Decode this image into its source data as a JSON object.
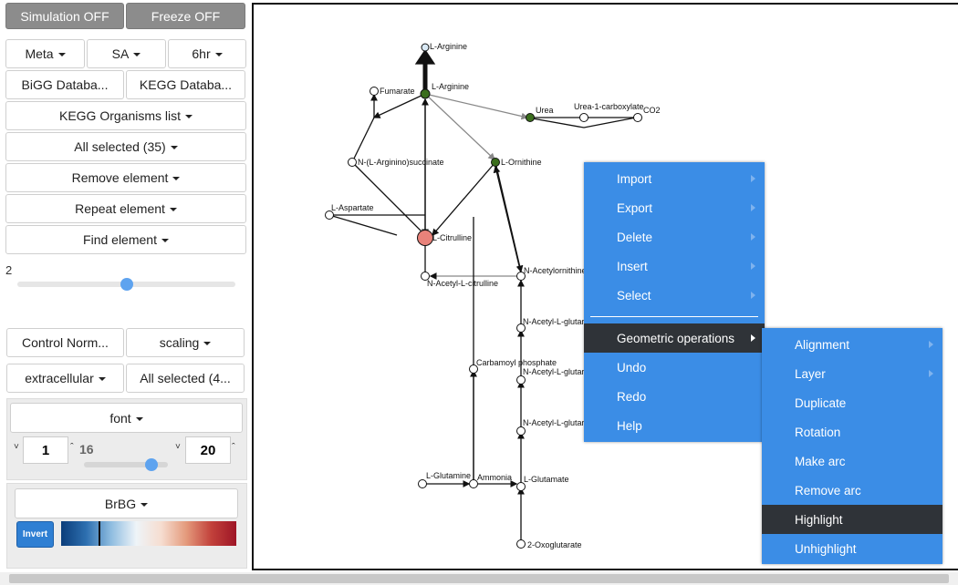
{
  "toolbar": {
    "simulation": "Simulation OFF",
    "freeze": "Freeze OFF"
  },
  "sidebar": {
    "meta": "Meta",
    "sa": "SA",
    "time": "6hr",
    "bigg": "BiGG Databa...",
    "kegg": "KEGG Databa...",
    "kegg_org": "KEGG Organisms list",
    "all_selected": "All selected (35)",
    "remove": "Remove element",
    "repeat": "Repeat element",
    "find": "Find element",
    "slider_value": "2",
    "slider_fraction": 0.5,
    "control_norm": "Control Norm...",
    "scaling": "scaling",
    "extracellular": "extracellular",
    "all_selected2": "All selected (4...",
    "font": "font",
    "font_min": "1",
    "font_cur": "16",
    "font_max": "20",
    "font_fraction": 0.8,
    "palette": "BrBG",
    "invert": "Invert"
  },
  "network": {
    "nodes": {
      "arg_top": "L-Arginine",
      "arg": "L-Arginine",
      "fumarate": "Fumarate",
      "urea": "Urea",
      "urea_carb": "Urea-1-carboxylate",
      "co2": "CO2",
      "argsucc": "N-(L-Arginino)succinate",
      "ornithine": "L-Ornithine",
      "aspartate": "L-Aspartate",
      "citrulline": "L-Citrulline",
      "nac_citrulline": "N-Acetyl-L-citrulline",
      "nac_ornithine": "N-Acetylornithine",
      "nac_glut1": "N-Acetyl-L-glutar",
      "carbamoyl": "Carbamoyl phosphate",
      "nac_glut2": "N-Acetyl-L-glutar",
      "nac_glut3": "N-Acetyl-L-glutar",
      "glutamine": "L-Glutamine",
      "ammonia": "Ammonia",
      "glutamate": "L-Glutamate",
      "oxoglutarate": "2-Oxoglutarate"
    },
    "colors": {
      "green": "#3b6e1d",
      "red": "#e8827a",
      "light": "#d9e9f5"
    }
  },
  "context_menu": {
    "items": [
      "Import",
      "Export",
      "Delete",
      "Insert",
      "Select",
      "Geometric operations",
      "Undo",
      "Redo",
      "Help"
    ],
    "active": "Geometric operations"
  },
  "submenu": {
    "items": [
      "Alignment",
      "Layer",
      "Duplicate",
      "Rotation",
      "Make arc",
      "Remove arc",
      "Highlight",
      "Unhighlight"
    ],
    "active": "Highlight"
  },
  "colors": {
    "menu_bg": "#3b8de6",
    "menu_active": "#2f3338",
    "grey_button": "#8c8c8c",
    "accent": "#5ea3ef"
  }
}
